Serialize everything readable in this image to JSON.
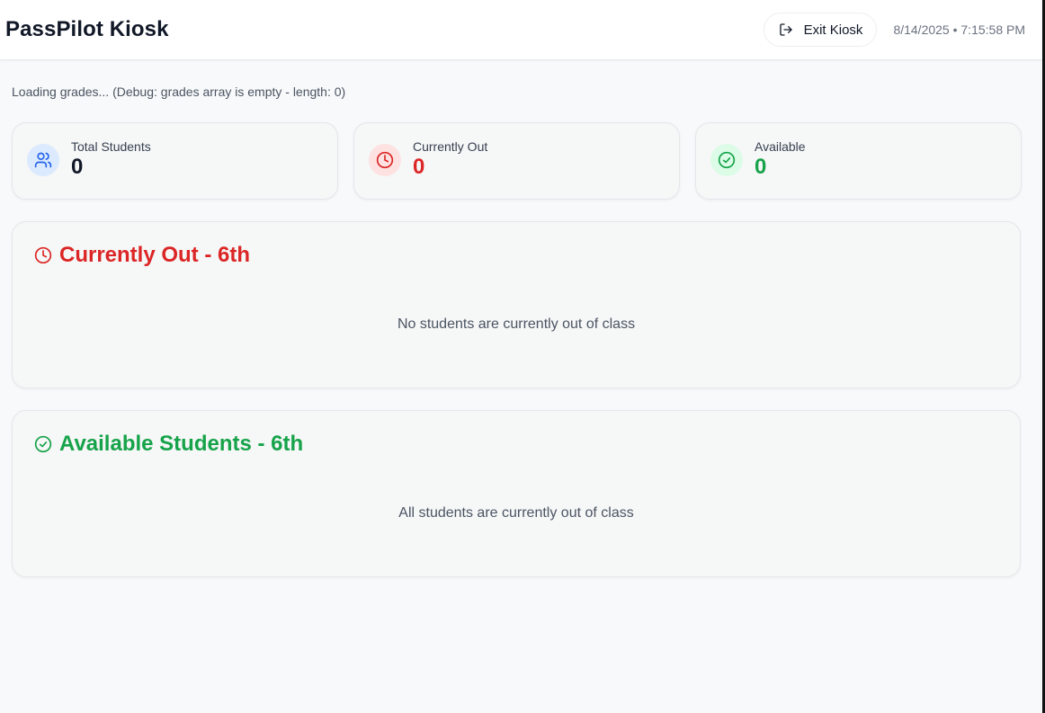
{
  "header": {
    "title": "PassPilot Kiosk",
    "exit_label": "Exit Kiosk",
    "datetime": "8/14/2025 • 7:15:58 PM"
  },
  "debug_text": "Loading grades... (Debug: grades array is empty - length: 0)",
  "stats": [
    {
      "label": "Total Students",
      "value": "0",
      "icon": "users-icon",
      "color": "#111827",
      "icon_bg": "#dbeafe",
      "icon_color": "#2563eb"
    },
    {
      "label": "Currently Out",
      "value": "0",
      "icon": "clock-icon",
      "color": "#dc2626",
      "icon_bg": "#fee2e2",
      "icon_color": "#dc2626"
    },
    {
      "label": "Available",
      "value": "0",
      "icon": "check-circle-icon",
      "color": "#16a34a",
      "icon_bg": "#dcfce7",
      "icon_color": "#16a34a"
    }
  ],
  "sections": {
    "currently_out": {
      "title": "Currently Out - 6th",
      "empty_text": "No students are currently out of class",
      "color": "#dc2626",
      "icon": "clock-icon"
    },
    "available": {
      "title": "Available Students - 6th",
      "empty_text": "All students are currently out of class",
      "color": "#16a34a",
      "icon": "check-circle-icon"
    }
  }
}
